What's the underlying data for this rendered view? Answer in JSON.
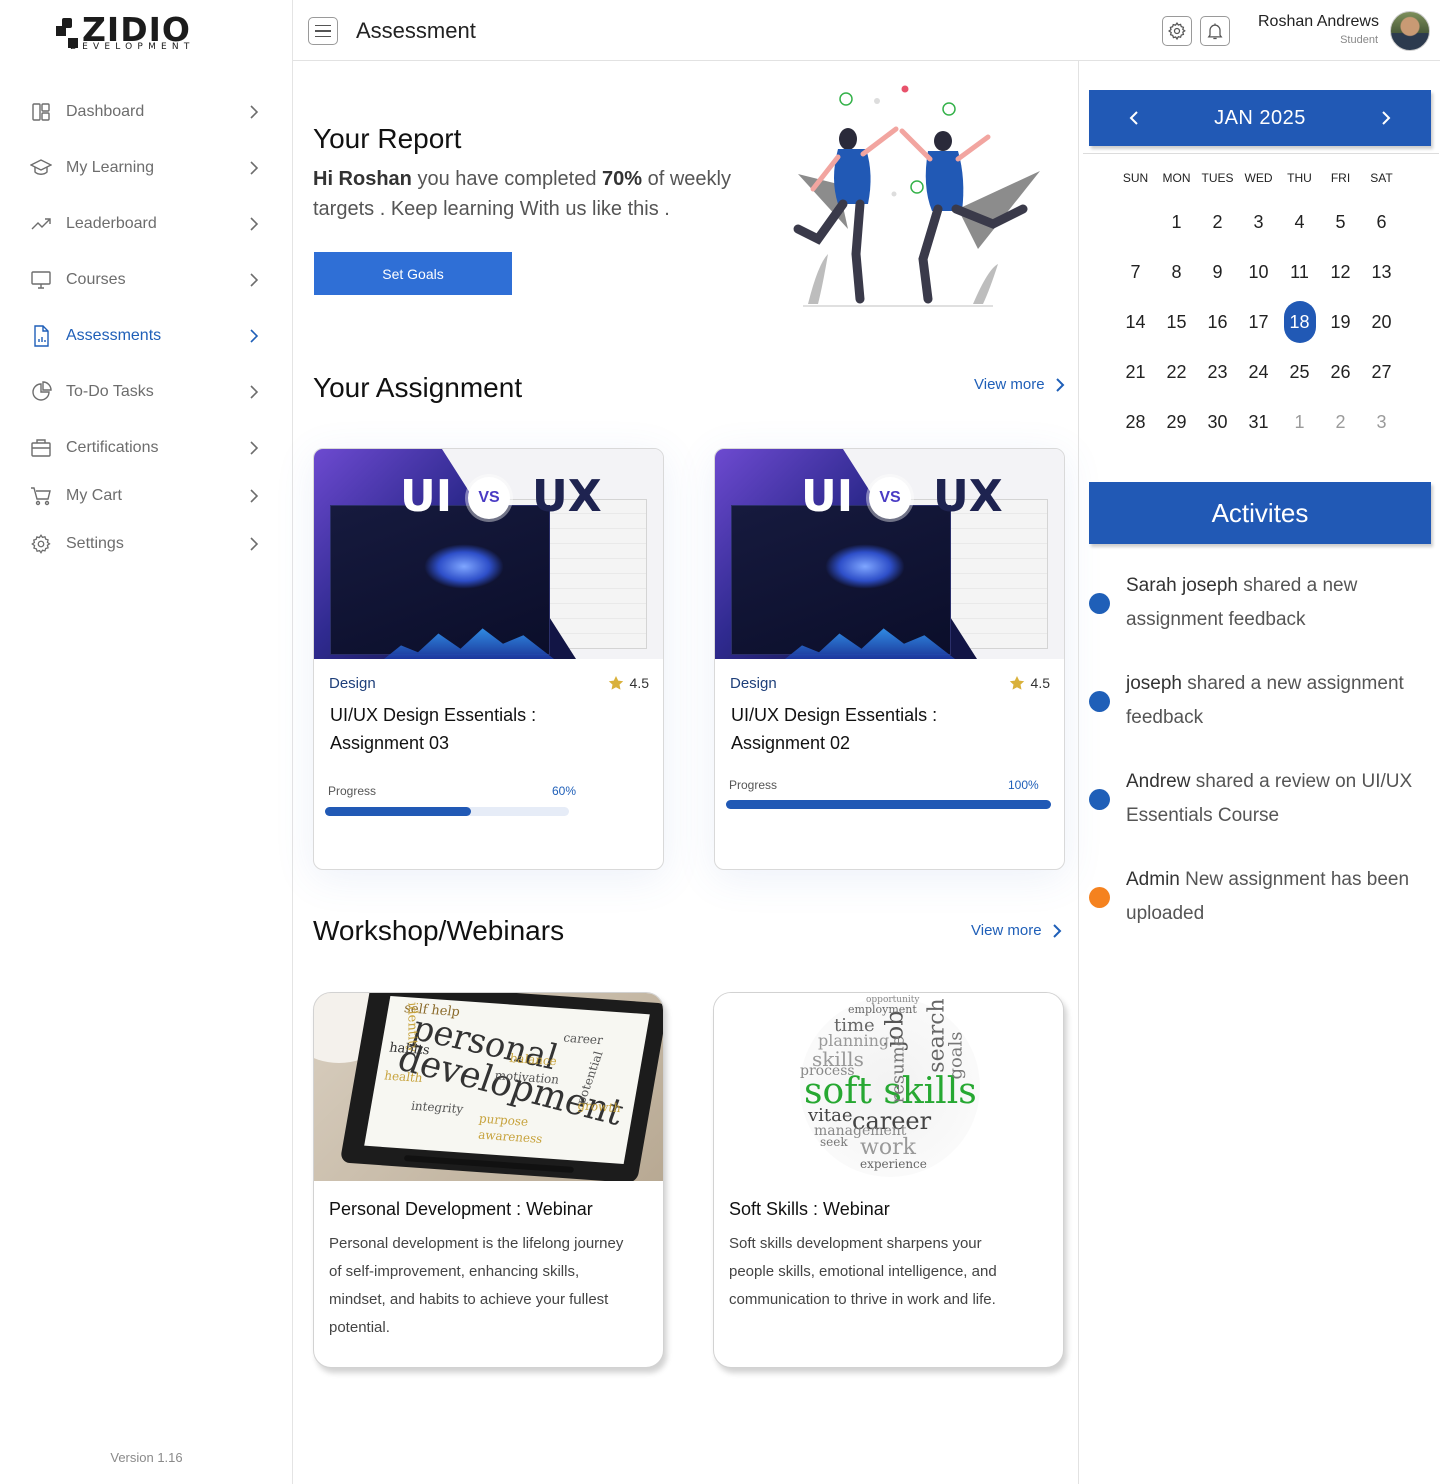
{
  "brand": {
    "name": "ZIDIO",
    "sub": "DEVELOPMENT"
  },
  "sidebar": {
    "items": [
      {
        "label": "Dashboard",
        "icon": "dashboard-icon"
      },
      {
        "label": "My Learning",
        "icon": "graduation-cap-icon"
      },
      {
        "label": "Leaderboard",
        "icon": "trend-icon"
      },
      {
        "label": "Courses",
        "icon": "monitor-icon"
      },
      {
        "label": "Assessments",
        "icon": "document-chart-icon",
        "active": true
      },
      {
        "label": "To-Do Tasks",
        "icon": "pie-chart-icon"
      },
      {
        "label": "Certifications",
        "icon": "briefcase-icon"
      },
      {
        "label": "My Cart",
        "icon": "cart-icon"
      },
      {
        "label": "Settings",
        "icon": "gear-icon"
      }
    ],
    "version": "Version 1.16",
    "active_color": "#1f5fb8"
  },
  "header": {
    "title": "Assessment",
    "user_name": "Roshan Andrews",
    "user_role": "Student"
  },
  "report": {
    "title": "Your Report",
    "greeting_bold": "Hi Roshan",
    "text_1": " you have completed ",
    "percent": "70%",
    "text_2": " of weekly targets . Keep learning With us like this .",
    "button": "Set Goals"
  },
  "assignments": {
    "title": "Your Assignment",
    "view_more": "View more",
    "cards": [
      {
        "category": "Design",
        "rating": "4.5",
        "title": "UI/UX Design Essentials : Assignment 03",
        "progress_label": "Progress",
        "progress_text": "60%",
        "progress": 0.6,
        "thumb_ui": "UI",
        "thumb_vs": "VS",
        "thumb_ux": "UX"
      },
      {
        "category": "Design",
        "rating": "4.5",
        "title": "UI/UX Design Essentials : Assignment 02",
        "progress_label": "Progress",
        "progress_text": "100%",
        "progress": 1.0,
        "thumb_ui": "UI",
        "thumb_vs": "VS",
        "thumb_ux": "UX"
      }
    ]
  },
  "workshops": {
    "title": "Workshop/Webinars",
    "view_more": "View more",
    "cards": [
      {
        "title": "Personal Development : Webinar",
        "description": "Personal development is the lifelong journey of self-improvement, enhancing skills, mindset, and habits to achieve your fullest potential.",
        "image_words": [
          "personal",
          "development",
          "self help",
          "identity",
          "habits",
          "balance",
          "motivation",
          "integrity",
          "purpose",
          "awareness",
          "career",
          "potential",
          "growth",
          "health"
        ]
      },
      {
        "title": "Soft Skills : Webinar",
        "description": "Soft skills development sharpens your people skills, emotional intelligence, and communication to thrive in work and life.",
        "image_words": [
          "soft skills",
          "job",
          "search",
          "career",
          "work",
          "time",
          "planning",
          "skills",
          "process",
          "vitae",
          "management",
          "resume",
          "goals",
          "employment",
          "opportunity",
          "experience",
          "seek"
        ]
      }
    ]
  },
  "calendar": {
    "month": "JAN 2025",
    "days_of_week": [
      "SUN",
      "MON",
      "TUES",
      "WED",
      "THU",
      "FRI",
      "SAT"
    ],
    "leading_blanks": 1,
    "days": [
      "1",
      "2",
      "3",
      "4",
      "5",
      "6",
      "7",
      "8",
      "9",
      "10",
      "11",
      "12",
      "13",
      "14",
      "15",
      "16",
      "17",
      "18",
      "19",
      "20",
      "21",
      "22",
      "23",
      "24",
      "25",
      "26",
      "27",
      "28",
      "29",
      "30",
      "31"
    ],
    "trailing": [
      "1",
      "2",
      "3"
    ],
    "selected": "18"
  },
  "activities": {
    "title": "Activites",
    "items": [
      {
        "actor": "Sarah joseph",
        "text": " shared a new assignment feedback",
        "dot": "#1f5fb8"
      },
      {
        "actor": " joseph",
        "text": " shared a new assignment feedback",
        "dot": "#1f5fb8"
      },
      {
        "actor": " Andrew",
        "text": " shared a review on UI/UX Essentials Course",
        "dot": "#1f5fb8"
      },
      {
        "actor": " Admin",
        "text": " New assignment has been uploaded",
        "dot": "#f5821f"
      }
    ]
  }
}
